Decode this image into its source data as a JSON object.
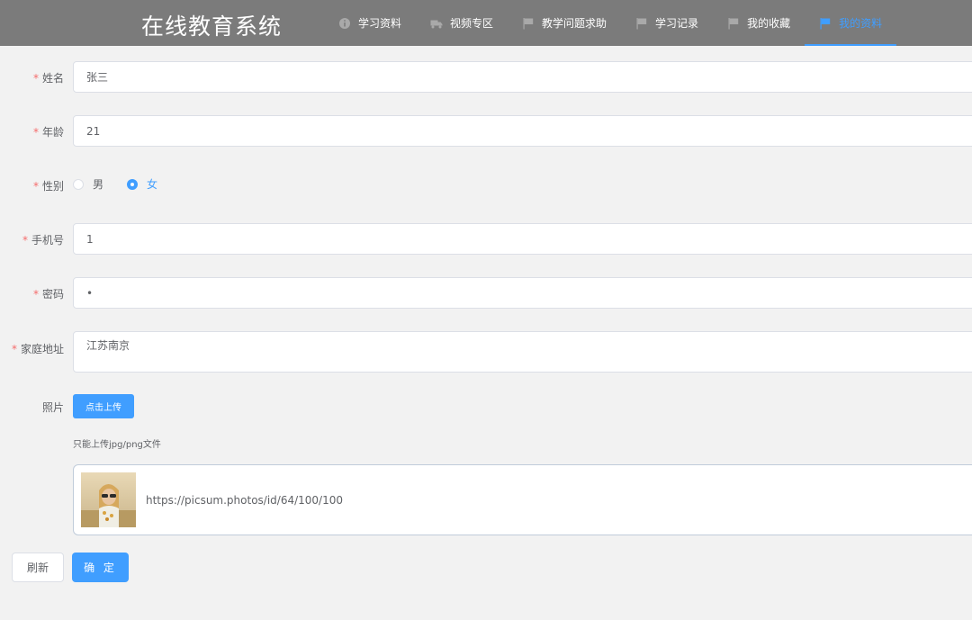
{
  "header": {
    "title": "在线教育系统",
    "nav": [
      {
        "label": "学习资料",
        "icon": "info-icon"
      },
      {
        "label": "视频专区",
        "icon": "truck-icon"
      },
      {
        "label": "教学问题求助",
        "icon": "flag-icon"
      },
      {
        "label": "学习记录",
        "icon": "flag-icon"
      },
      {
        "label": "我的收藏",
        "icon": "flag-icon"
      },
      {
        "label": "我的资料",
        "icon": "flag-icon",
        "active": true
      }
    ],
    "active_color": "#409eff"
  },
  "form": {
    "name": {
      "label": "姓名",
      "value": "张三"
    },
    "age": {
      "label": "年龄",
      "value": "21"
    },
    "gender": {
      "label": "性别",
      "options": [
        "男",
        "女"
      ],
      "selected": "女"
    },
    "phone": {
      "label": "手机号",
      "value": "1"
    },
    "password": {
      "label": "密码",
      "value": "•"
    },
    "address": {
      "label": "家庭地址",
      "value": "江苏南京"
    },
    "photo": {
      "label": "照片",
      "upload_label": "点击上传",
      "tip": "只能上传jpg/png文件",
      "file_name": "https://picsum.photos/id/64/100/100"
    }
  },
  "actions": {
    "refresh_label": "刷新",
    "confirm_label": "确 定"
  }
}
